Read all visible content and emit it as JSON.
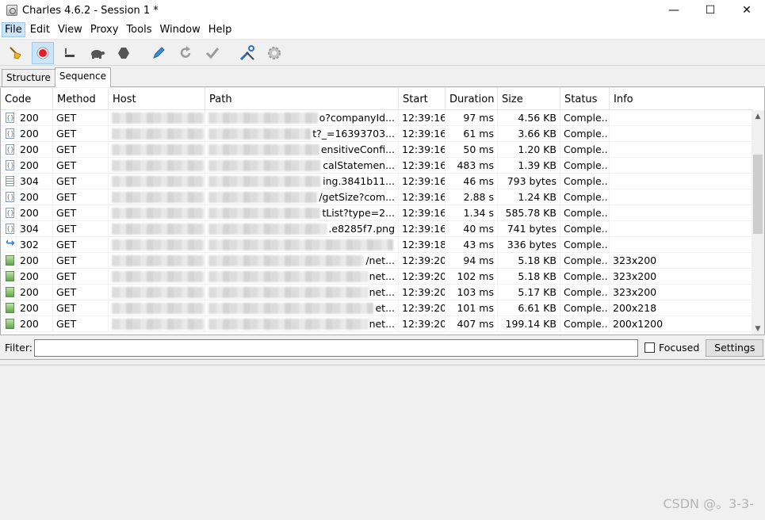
{
  "window": {
    "title": "Charles 4.6.2 - Session 1 *",
    "minimize": "—",
    "maximize": "☐",
    "close": "✕"
  },
  "menu": [
    {
      "label": "File",
      "active": true
    },
    {
      "label": "Edit"
    },
    {
      "label": "View"
    },
    {
      "label": "Proxy"
    },
    {
      "label": "Tools"
    },
    {
      "label": "Window"
    },
    {
      "label": "Help"
    }
  ],
  "toolbar": {
    "icons": [
      "broom-icon",
      "record-icon",
      "throttle-icon",
      "turtle-icon",
      "stop-hexagon-icon",
      "pen-icon",
      "refresh-icon",
      "check-icon",
      "tools-icon",
      "gear-icon"
    ]
  },
  "tabs": [
    {
      "label": "Structure",
      "selected": false
    },
    {
      "label": "Sequence",
      "selected": true
    }
  ],
  "columns": [
    "Code",
    "Method",
    "Host",
    "Path",
    "Start",
    "Duration",
    "Size",
    "Status",
    "Info"
  ],
  "rows": [
    {
      "icon": "json",
      "code": "200",
      "method": "GET",
      "path": "o?companyId...",
      "start": "12:39:16",
      "duration": "97 ms",
      "size": "4.56 KB",
      "status": "Comple...",
      "info": ""
    },
    {
      "icon": "json",
      "code": "200",
      "method": "GET",
      "path": "t?_=16393703...",
      "start": "12:39:16",
      "duration": "61 ms",
      "size": "3.66 KB",
      "status": "Comple...",
      "info": ""
    },
    {
      "icon": "json",
      "code": "200",
      "method": "GET",
      "path": "ensitiveConfi...",
      "start": "12:39:16",
      "duration": "50 ms",
      "size": "1.20 KB",
      "status": "Comple...",
      "info": ""
    },
    {
      "icon": "json",
      "code": "200",
      "method": "GET",
      "path": "calStatemen...",
      "start": "12:39:16",
      "duration": "483 ms",
      "size": "1.39 KB",
      "status": "Comple...",
      "info": ""
    },
    {
      "icon": "lines",
      "code": "304",
      "method": "GET",
      "path": "ing.3841b11...",
      "start": "12:39:16",
      "duration": "46 ms",
      "size": "793 bytes",
      "status": "Comple...",
      "info": ""
    },
    {
      "icon": "json",
      "code": "200",
      "method": "GET",
      "path": "/getSize?com...",
      "start": "12:39:16",
      "duration": "2.88 s",
      "size": "1.24 KB",
      "status": "Comple...",
      "info": ""
    },
    {
      "icon": "json",
      "code": "200",
      "method": "GET",
      "path": "tList?type=2...",
      "start": "12:39:16",
      "duration": "1.34 s",
      "size": "585.78 KB",
      "status": "Comple...",
      "info": ""
    },
    {
      "icon": "json",
      "code": "304",
      "method": "GET",
      "path": ".e8285f7.png",
      "start": "12:39:16",
      "duration": "40 ms",
      "size": "741 bytes",
      "status": "Comple...",
      "info": ""
    },
    {
      "icon": "redirect",
      "code": "302",
      "method": "GET",
      "path": "",
      "start": "12:39:18",
      "duration": "43 ms",
      "size": "336 bytes",
      "status": "Comple...",
      "info": ""
    },
    {
      "icon": "img",
      "code": "200",
      "method": "GET",
      "path": "/net...",
      "start": "12:39:20",
      "duration": "94 ms",
      "size": "5.18 KB",
      "status": "Comple...",
      "info": "323x200"
    },
    {
      "icon": "img",
      "code": "200",
      "method": "GET",
      "path": "net...",
      "start": "12:39:20",
      "duration": "102 ms",
      "size": "5.18 KB",
      "status": "Comple...",
      "info": "323x200"
    },
    {
      "icon": "img",
      "code": "200",
      "method": "GET",
      "path": "net...",
      "start": "12:39:20",
      "duration": "103 ms",
      "size": "5.17 KB",
      "status": "Comple...",
      "info": "323x200"
    },
    {
      "icon": "img",
      "code": "200",
      "method": "GET",
      "path": "et...",
      "start": "12:39:20",
      "duration": "101 ms",
      "size": "6.61 KB",
      "status": "Comple...",
      "info": "200x218"
    },
    {
      "icon": "img",
      "code": "200",
      "method": "GET",
      "path": "net...",
      "start": "12:39:20",
      "duration": "407 ms",
      "size": "199.14 KB",
      "status": "Comple...",
      "info": "200x1200"
    }
  ],
  "filter": {
    "label": "Filter:",
    "value": "",
    "focused_label": "Focused",
    "settings_label": "Settings"
  },
  "watermark": "CSDN @。3-3-"
}
